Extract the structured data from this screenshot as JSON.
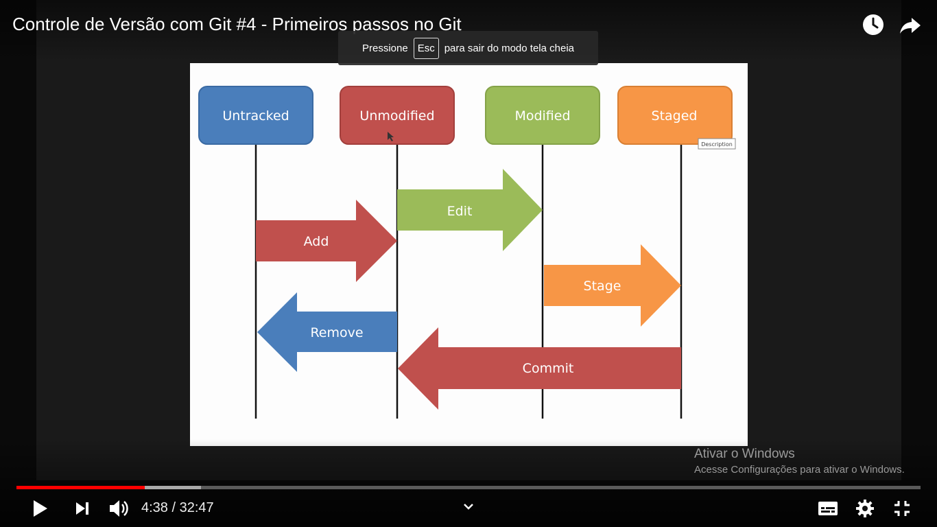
{
  "video": {
    "title": "Controle de Versão com Git #4 - Primeiros passos no Git",
    "progress_fraction": 0.142,
    "buffered_fraction": 0.204
  },
  "fullscreen_toast": {
    "before": "Pressione",
    "key": "Esc",
    "after": "para sair do modo tela cheia"
  },
  "slide": {
    "states": [
      "Untracked",
      "Unmodified",
      "Modified",
      "Staged"
    ],
    "state_colors": [
      "#4a7ebb",
      "#c0504d",
      "#9bbb59",
      "#f79646"
    ],
    "arrows": [
      "Edit",
      "Add",
      "Stage",
      "Remove",
      "Commit"
    ],
    "arrow_colors": {
      "edit": "#9bbb59",
      "add": "#c0504d",
      "stage": "#f79646",
      "remove": "#4a7ebb",
      "commit": "#c0504d"
    },
    "tooltip": "Description"
  },
  "watermark": {
    "line1": "Ativar o Windows",
    "line2": "Acesse Configurações para ativar o Windows."
  },
  "controls": {
    "current_time": "4:38",
    "separator": " / ",
    "duration": "32:47"
  },
  "icons": {
    "watch_later": "clock-icon",
    "share": "share-icon",
    "play": "play-icon",
    "next": "next-icon",
    "volume": "volume-icon",
    "chevron": "chevron-down-icon",
    "subtitles": "subtitles-icon",
    "settings": "gear-icon",
    "exit_fullscreen": "exit-fullscreen-icon"
  }
}
